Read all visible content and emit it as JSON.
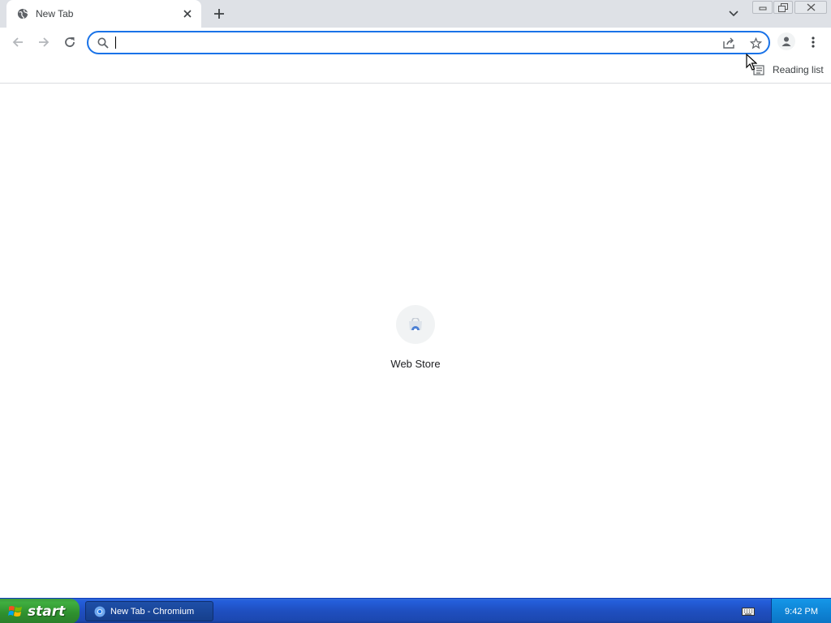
{
  "browser": {
    "tab": {
      "title": "New Tab",
      "favicon": "globe-icon"
    },
    "omnibox": {
      "value": "",
      "placeholder": ""
    },
    "bookmarks_bar": {
      "reading_list_label": "Reading list"
    }
  },
  "new_tab_page": {
    "shortcuts": [
      {
        "label": "Web Store",
        "icon": "web-store-icon"
      }
    ]
  },
  "taskbar": {
    "start_label": "start",
    "task_items": [
      {
        "label": "New Tab - Chromium",
        "icon": "chromium-icon"
      }
    ],
    "clock": "9:42 PM"
  },
  "colors": {
    "accent": "#1a73e8",
    "tabstrip_bg": "#dee1e6",
    "taskbar_blue": "#245edb",
    "start_green": "#3fae3f"
  }
}
